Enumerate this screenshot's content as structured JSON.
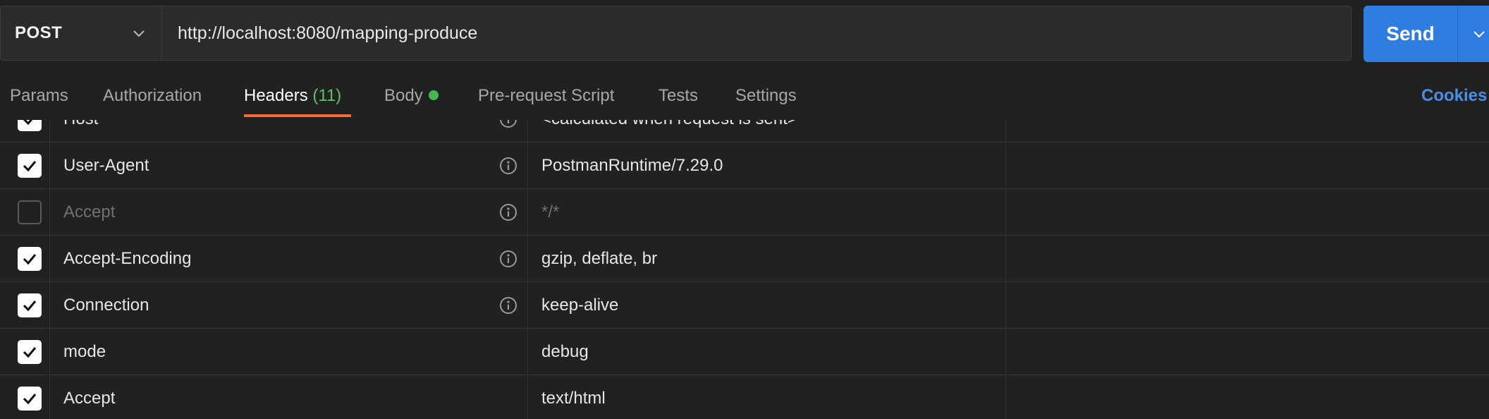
{
  "request": {
    "method": "POST",
    "url": "http://localhost:8080/mapping-produce",
    "send_label": "Send"
  },
  "tabs": {
    "params": "Params",
    "authorization": "Authorization",
    "headers": "Headers",
    "headers_count": "(11)",
    "body": "Body",
    "prerequest": "Pre-request Script",
    "tests": "Tests",
    "settings": "Settings",
    "cookies": "Cookies"
  },
  "headers": [
    {
      "key": "Host",
      "value": "<calculated when request is sent>",
      "checked": true
    },
    {
      "key": "User-Agent",
      "value": "PostmanRuntime/7.29.0",
      "checked": true
    },
    {
      "key": "Accept",
      "value": "*/*",
      "checked": false
    },
    {
      "key": "Accept-Encoding",
      "value": "gzip, deflate, br",
      "checked": true
    },
    {
      "key": "Connection",
      "value": "keep-alive",
      "checked": true
    },
    {
      "key": "mode",
      "value": "debug",
      "checked": true
    },
    {
      "key": "Accept",
      "value": "text/html",
      "checked": true
    }
  ],
  "colors": {
    "accent": "#ff6c37",
    "send": "#2f7de1",
    "link": "#4a8ee8",
    "status_dot": "#3fb950"
  }
}
